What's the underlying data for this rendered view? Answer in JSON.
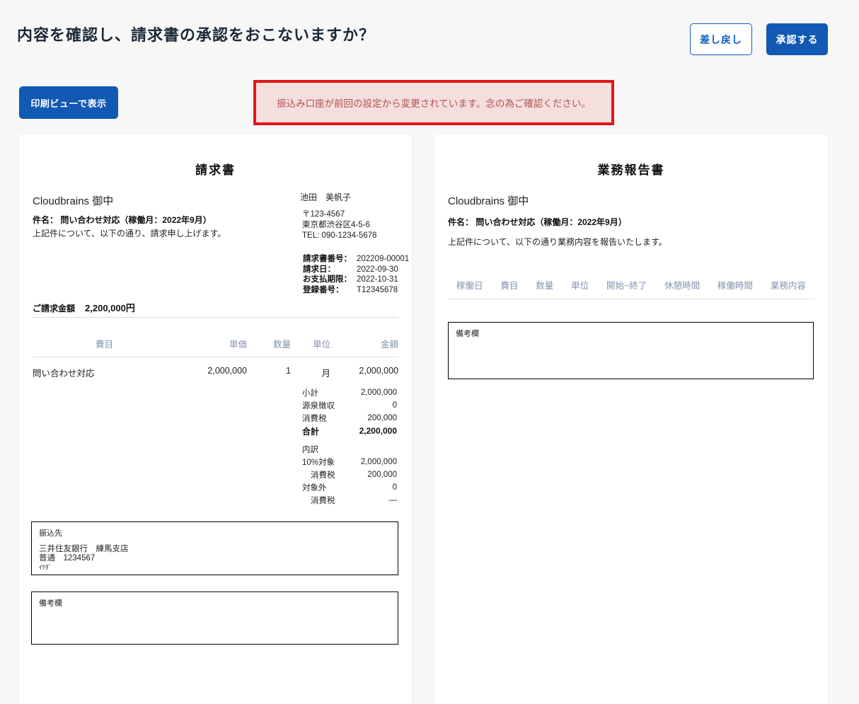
{
  "page": {
    "title": "内容を確認し、請求書の承認をおこないますか？",
    "reject_button": "差し戻し",
    "approve_button": "承認する",
    "print_button": "印刷ビューで表示",
    "alert_message": "振込み口座が前回の設定から変更されています。念の為ご確認ください。"
  },
  "colors": {
    "accent_blue": "#1259b4",
    "title_navy": "#1b2838",
    "table_header_blue": "#8193b0",
    "alert_border": "#e01717",
    "alert_background": "#f5dede",
    "alert_text": "#b25252"
  },
  "invoice": {
    "doc_title": "請求書",
    "recipient": "Cloudbrains 御中",
    "subject_label": "件名：",
    "subject": "問い合わせ対応（稼働月：2022年9月）",
    "intro": "上記件について、以下の通り、請求申し上げます。",
    "issuer": {
      "name": "池田　美帆子",
      "postal": "〒123-4567",
      "address": "東京都渋谷区4-5-6",
      "tel": "TEL: 090-1234-5678"
    },
    "meta": [
      {
        "label": "請求書番号：",
        "value": "202209-00001"
      },
      {
        "label": "請求日：",
        "value": "2022-09-30"
      },
      {
        "label": "お支払期限：",
        "value": "2022-10-31"
      },
      {
        "label": "登録番号：",
        "value": "T12345678"
      }
    ],
    "grand_total_label": "ご請求金額",
    "grand_total_value": "2,200,000円",
    "table": {
      "headers": [
        "費目",
        "単価",
        "数量",
        "単位",
        "金額"
      ],
      "rows": [
        {
          "item": "問い合わせ対応",
          "unit_price": "2,000,000",
          "qty": "1",
          "unit": "月",
          "amount": "2,000,000"
        }
      ]
    },
    "summary": [
      {
        "label": "小計",
        "value": "2,000,000"
      },
      {
        "label": "源泉徴収",
        "value": "0"
      },
      {
        "label": "消費税",
        "value": "200,000"
      },
      {
        "label": "合計",
        "value": "2,200,000"
      }
    ],
    "breakdown_caption": "内訳",
    "breakdown": [
      {
        "label": "10%対象",
        "value": "2,000,000"
      },
      {
        "label": "消費税",
        "value": "200,000"
      },
      {
        "label": "対象外",
        "value": "0"
      },
      {
        "label": "消費税",
        "value": "—"
      }
    ],
    "bank": {
      "box_label": "振込先",
      "line1": "三井住友銀行　練馬支店",
      "line2": "普通　1234567",
      "line3": "ｲｹﾀﾞ"
    },
    "notes_label": "備考欄"
  },
  "report": {
    "doc_title": "業務報告書",
    "recipient": "Cloudbrains 御中",
    "subject_label": "件名：",
    "subject": "問い合わせ対応（稼働月：2022年9月）",
    "intro": "上記件について、以下の通り業務内容を報告いたします。",
    "headers": [
      "稼働日",
      "費目",
      "数量",
      "単位",
      "開始~終了",
      "休憩時間",
      "稼働時間",
      "業務内容"
    ],
    "notes_label": "備考欄"
  }
}
